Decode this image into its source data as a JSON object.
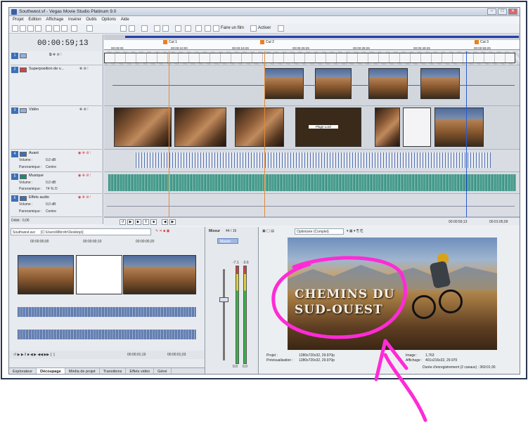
{
  "window": {
    "title": "Southwest.vf - Vegas Movie Studio Platinum 9.0",
    "controls": [
      "–",
      "□",
      "✕"
    ]
  },
  "menu": [
    "Projet",
    "Edition",
    "Affichage",
    "Insérer",
    "Outils",
    "Options",
    "Aide"
  ],
  "toolbar": {
    "make_movie_label": "Faire un film",
    "activate_label": "Activer"
  },
  "timecode": "00:00:59;13",
  "markers": [
    {
      "label": "Cut 1"
    },
    {
      "label": "Cut 2"
    },
    {
      "label": "Cut 3"
    }
  ],
  "ruler_ticks": [
    "00:00:00",
    "00:00:10:00",
    "00:00:19:29",
    "00:00:29:29",
    "00:00:39:29",
    "00:00:49:29",
    "00:00:59:29"
  ],
  "tracks": [
    {
      "num": "1",
      "name": "",
      "color": "#8fb0e0"
    },
    {
      "num": "2",
      "name": "Superposition de v...",
      "color": "#c94646"
    },
    {
      "num": "3",
      "name": "Vidéo",
      "color": "#8fb0e0"
    },
    {
      "num": "4",
      "name": "Avant",
      "color": "#3b6fb8",
      "volume_label": "Volume :",
      "volume_value": "0,0 dB",
      "pan_label": "Panoramique :",
      "pan_value": "Centre"
    },
    {
      "num": "5",
      "name": "Musique",
      "color": "#1a8a7a",
      "volume_label": "Volume :",
      "volume_value": "0,0 dB",
      "pan_label": "Panoramique :",
      "pan_value": "74 % O"
    },
    {
      "num": "6",
      "name": "Effets audio",
      "color": "#3b6fb8",
      "volume_label": "Volume :",
      "volume_value": "0,0 dB",
      "pan_label": "Panoramique :",
      "pan_value": "Centre"
    }
  ],
  "rate_label": "Débit : 0,00",
  "transport": {
    "left_time": "00:00:59;13",
    "right_time": "00:01:05;09"
  },
  "clip_label": "Plage Lord",
  "trimmer": {
    "file": "Southwest.avc",
    "path": "[C:\\Users\\Mbrohr\\Desktop\\]",
    "tick_left": "00:00:00;00",
    "tick_mid": "00:00:00;10",
    "tick_right": "00:00:00;20",
    "time_left": "00:00:01;19",
    "time_right": "00:00:01;03"
  },
  "bottom_tabs": [
    "Explorateur",
    "Découpage",
    "Média de projet",
    "Transitions",
    "Effets vidéo",
    "Géné"
  ],
  "active_tab_index": 1,
  "mixer": {
    "title": "Mixeur",
    "value": "44 / 16",
    "master": "Master",
    "level_left": "-7.1",
    "level_right": "-3.6",
    "bottom_left": "0.0",
    "bottom_right": "0.0"
  },
  "preview": {
    "quality": "Optimisée (Complet)",
    "title_line1": "CHEMINS DU",
    "title_line2": "SUD-OUEST",
    "project_label": "Projet :",
    "project_value": "1280x720x32, 29.970p",
    "preview_label": "Prévisualisation :",
    "preview_value": "1280x720x32, 29.970p",
    "frame_right_label": "Image :",
    "frame_right_value": "1,763",
    "display_right_label": "Affichage :",
    "display_right_value": "401x216x32, 29.970",
    "record_label": "Durée d'enregistrement (2 canaux) : 369:01:30"
  },
  "colors": {
    "annotation": "#ff2bd6",
    "accent": "#3b6fb8",
    "music": "#1a8a7a"
  }
}
